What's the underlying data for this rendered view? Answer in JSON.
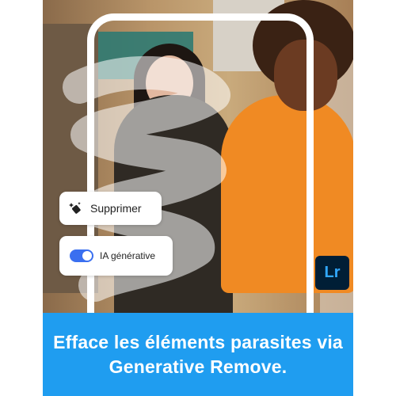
{
  "photo": {
    "description_icon": "photo-scene"
  },
  "chips": {
    "remove_label": "Supprimer",
    "remove_icon": "eraser-sparkle-icon",
    "generative_label": "IA générative",
    "generative_toggle_on": true
  },
  "badge": {
    "label": "Lr",
    "bg_color": "#001e36",
    "fg_color": "#31a8ff"
  },
  "caption": {
    "text": "Efface les éléments parasites via Generative Remove."
  },
  "colors": {
    "banner": "#1f9df0",
    "toggle": "#3a6ff0"
  }
}
